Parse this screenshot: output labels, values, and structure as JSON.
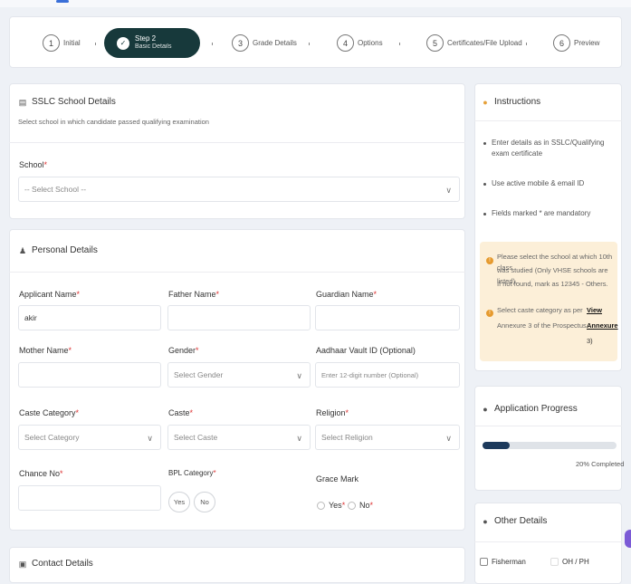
{
  "stepper": {
    "steps": [
      {
        "num": "1",
        "label": "Initial"
      },
      {
        "num": "",
        "title": "Step 2",
        "subtitle": "Basic Details"
      },
      {
        "num": "3",
        "label": "Grade Details"
      },
      {
        "num": "4",
        "label": "Options"
      },
      {
        "num": "5",
        "label": "Certificates/File Upload"
      },
      {
        "num": "6",
        "label": "Preview"
      }
    ],
    "active_check": "✓"
  },
  "school": {
    "title": "SSLC School Details",
    "subtitle": "Select school in which candidate passed qualifying examination",
    "label": "School",
    "placeholder": "-- Select School --"
  },
  "personal": {
    "title": "Personal Details",
    "applicant_name": {
      "label": "Applicant Name",
      "value": "akir"
    },
    "father_name": {
      "label": "Father Name",
      "value": ""
    },
    "guardian_name": {
      "label": "Guardian Name",
      "value": ""
    },
    "mother_name": {
      "label": "Mother Name",
      "value": ""
    },
    "gender": {
      "label": "Gender",
      "placeholder": "Select Gender"
    },
    "aadhaar": {
      "label": "Aadhaar Vault ID (Optional)",
      "placeholder": "Enter 12-digit number (Optional)"
    },
    "caste_category": {
      "label": "Caste Category",
      "placeholder": "Select Category"
    },
    "caste": {
      "label": "Caste",
      "placeholder": "Select Caste"
    },
    "religion": {
      "label": "Religion",
      "placeholder": "Select Religion"
    },
    "chance_no": {
      "label": "Chance No",
      "value": ""
    },
    "bpl": {
      "label": "BPL Category",
      "yes": "Yes",
      "no": "No"
    },
    "grace_mark": {
      "label": "Grace Mark",
      "yes": "Yes",
      "no": "No"
    }
  },
  "contact": {
    "title": "Contact Details"
  },
  "required_mark": "*",
  "instructions": {
    "title": "Instructions",
    "items": [
      "Enter details as in SSLC/Qualifying exam certificate",
      "Use active mobile & email ID",
      "Fields marked * are mandatory"
    ],
    "note1": [
      "Please select the school at which 10th class",
      "was studied (Only VHSE schools are listed).",
      "If not found, mark as 12345 - Others."
    ],
    "note2_text": [
      "Select caste category as per",
      "Annexure 3 of the Prospectus."
    ],
    "note2_link": [
      "View",
      "Annexure",
      "3)"
    ]
  },
  "progress": {
    "title": "Application Progress",
    "percent": 20,
    "label": "20% Completed"
  },
  "other": {
    "title": "Other Details",
    "fisherman": "Fisherman",
    "oh_ph": "OH / PH"
  },
  "colors": {
    "accent": "#17393b",
    "progress": "#1d3a5c",
    "note_bg": "#fcefd8",
    "required": "#dd3333"
  }
}
